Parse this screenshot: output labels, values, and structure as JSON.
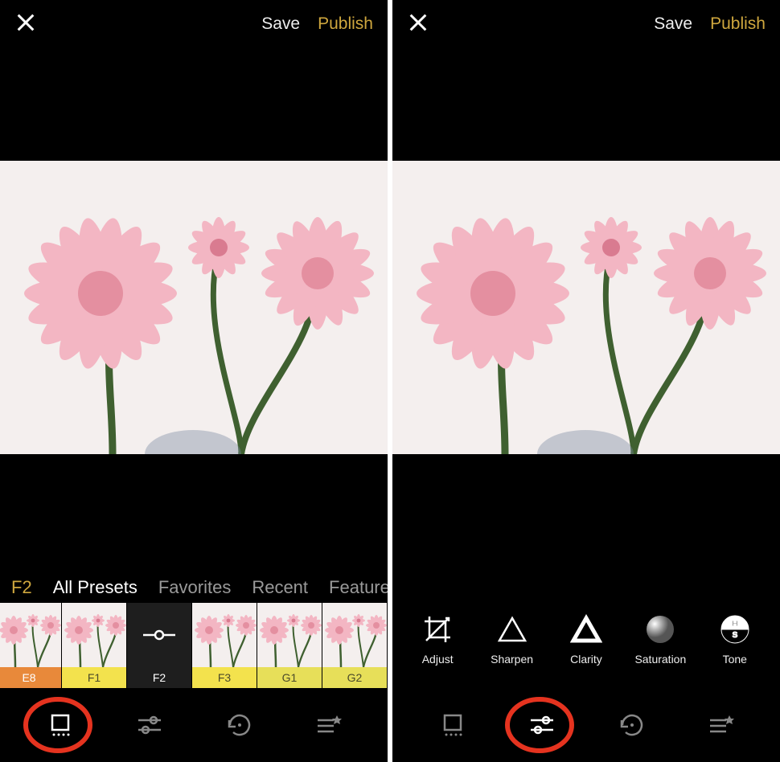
{
  "header": {
    "save_label": "Save",
    "publish_label": "Publish"
  },
  "left": {
    "active_preset": "F2",
    "category_tabs": [
      "All Presets",
      "Favorites",
      "Recent",
      "Featured"
    ],
    "active_category": "All Presets",
    "presets": [
      {
        "code": "E8",
        "color": "#e8893a"
      },
      {
        "code": "F1",
        "color": "#f3e24d"
      },
      {
        "code": "F2",
        "color": "#1e1e1e",
        "current": true
      },
      {
        "code": "F3",
        "color": "#f3e24d"
      },
      {
        "code": "G1",
        "color": "#e7df59"
      },
      {
        "code": "G2",
        "color": "#e7df59"
      }
    ],
    "bottom_tabs": [
      "presets",
      "adjust",
      "history",
      "presets-manage"
    ],
    "active_bottom": "presets"
  },
  "right": {
    "tools": [
      {
        "name": "Adjust",
        "icon": "crop"
      },
      {
        "name": "Sharpen",
        "icon": "triangle"
      },
      {
        "name": "Clarity",
        "icon": "triangle-bold"
      },
      {
        "name": "Saturation",
        "icon": "sphere"
      },
      {
        "name": "Tone",
        "icon": "hs"
      }
    ],
    "bottom_tabs": [
      "presets",
      "adjust",
      "history",
      "presets-manage"
    ],
    "active_bottom": "adjust"
  }
}
